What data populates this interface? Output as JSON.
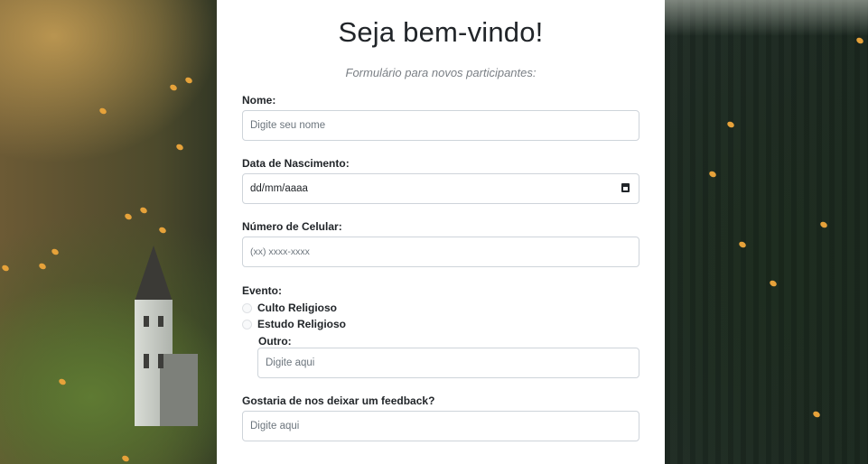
{
  "page": {
    "title": "Seja bem-vindo!",
    "subtitle": "Formulário para novos participantes:"
  },
  "form": {
    "name": {
      "label": "Nome:",
      "placeholder": "Digite seu nome"
    },
    "birthdate": {
      "label": "Data de Nascimento:",
      "value": "dd/mm/aaaa",
      "icon": "calendar-icon"
    },
    "phone": {
      "label": "Número de Celular:",
      "placeholder": "(xx) xxxx-xxxx"
    },
    "event": {
      "label": "Evento:",
      "options": [
        "Culto Religioso",
        "Estudo Religioso"
      ],
      "other_label": "Outro:",
      "other_placeholder": "Digite aqui"
    },
    "feedback": {
      "label": "Gostaria de nos deixar um feedback?",
      "placeholder": "Digite aqui"
    }
  },
  "colors": {
    "panel": "#ffffff",
    "input_border": "#ced4da",
    "text": "#212529",
    "muted": "#6c757d",
    "leaf": "#e6a23a"
  }
}
